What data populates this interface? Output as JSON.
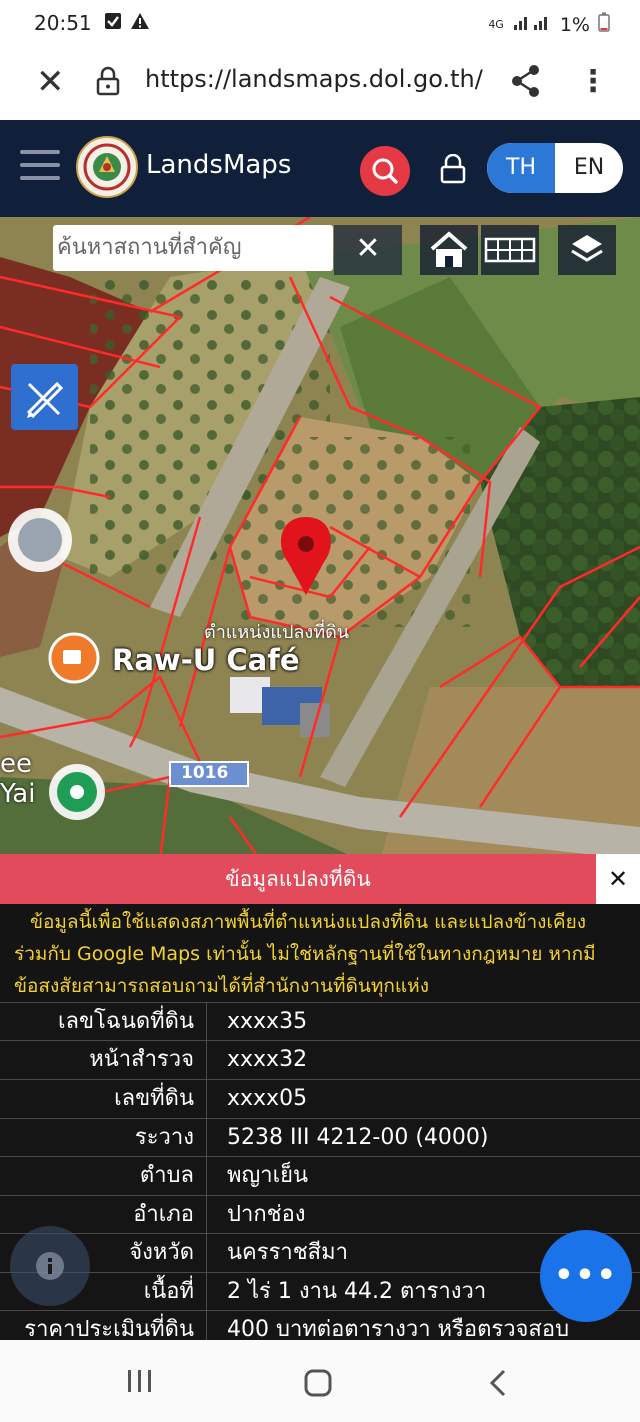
{
  "status_bar": {
    "time": "20:51",
    "network": "4G",
    "battery": "1%",
    "icons": [
      "checkbox-notification-icon",
      "warning-icon",
      "signal-icon",
      "battery-icon"
    ]
  },
  "browser": {
    "url": "https://landsmaps.dol.go.th/"
  },
  "app": {
    "brand": "LandsMaps",
    "lang_th": "TH",
    "lang_en": "EN"
  },
  "map": {
    "search_placeholder": "ค้นหาสถานที่สำคัญ",
    "clear_label": "✕",
    "marker_label": "ตำแหน่งแปลงที่ดิน",
    "place_label": "Raw-U Café",
    "road_number": "1016",
    "edge_label_1": "ee",
    "edge_label_2": "Yai"
  },
  "panel": {
    "title": "ข้อมูลแปลงที่ดิน",
    "close_label": "✕",
    "disclaimer_lines": [
      "ข้อมูลนี้เพื่อใช้แสดงสภาพพื้นที่ตำแหน่งแปลงที่ดิน และแปลงข้างเคียง",
      "ร่วมกับ Google Maps เท่านั้น ไม่ใช่หลักฐานที่ใช้ในทางกฎหมาย หากมี",
      "ข้อสงสัยสามารถสอบถามได้ที่สำนักงานที่ดินทุกแห่ง"
    ],
    "rows": [
      {
        "key": "เลขโฉนดที่ดิน",
        "value": "xxxx35"
      },
      {
        "key": "หน้าสำรวจ",
        "value": "xxxx32"
      },
      {
        "key": "เลขที่ดิน",
        "value": "xxxx05"
      },
      {
        "key": "ระวาง",
        "value": "5238 III 4212-00 (4000)"
      },
      {
        "key": "ตำบล",
        "value": "พญาเย็น"
      },
      {
        "key": "อำเภอ",
        "value": "ปากช่อง"
      },
      {
        "key": "จังหวัด",
        "value": "นครราชสีมา"
      },
      {
        "key": "เนื้อที่",
        "value": "2 ไร่ 1 งาน 44.2 ตารางวา"
      },
      {
        "key": "ราคาประเมินที่ดิน",
        "value": "400 บาทต่อตารางวา หรือตรวจสอบ"
      }
    ],
    "fab_label": "•••"
  },
  "colors": {
    "appbar": "#10203a",
    "accent_blue": "#2b78d6",
    "search_red": "#e63946",
    "panel_header": "#e24b5b",
    "disclaimer_text": "#f2d22e",
    "parcel_line": "#ff2a2a"
  }
}
